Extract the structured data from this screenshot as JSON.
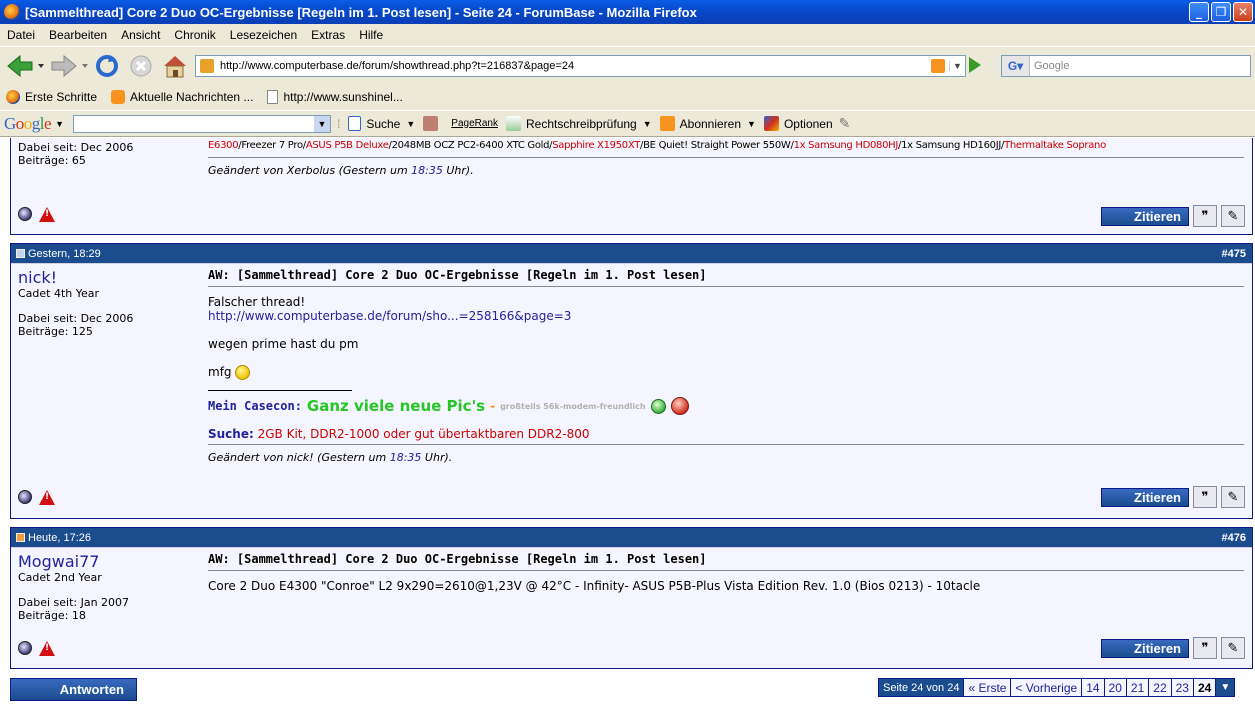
{
  "window": {
    "title": "[Sammelthread] Core 2 Duo OC-Ergebnisse [Regeln im 1. Post lesen] - Seite 24 - ForumBase - Mozilla Firefox"
  },
  "menu": [
    "Datei",
    "Bearbeiten",
    "Ansicht",
    "Chronik",
    "Lesezeichen",
    "Extras",
    "Hilfe"
  ],
  "nav": {
    "url": "http://www.computerbase.de/forum/showthread.php?t=216837&page=24",
    "search_placeholder": "Google"
  },
  "bookmarks": [
    {
      "label": "Erste Schritte",
      "icon": "firefox-icon"
    },
    {
      "label": "Aktuelle Nachrichten ...",
      "icon": "rss-icon"
    },
    {
      "label": "http://www.sunshinel...",
      "icon": "page-icon"
    }
  ],
  "gtoolbar": {
    "logo": "Google",
    "suche": "Suche",
    "pagerank": "PageRank",
    "spell": "Rechtschreibprüfung",
    "subscribe": "Abonnieren",
    "options": "Optionen"
  },
  "posts": [
    {
      "joined": "Dabei seit: Dec 2006",
      "posts": "Beiträge: 65",
      "signature": {
        "parts": [
          {
            "text": "E6300",
            "color": "red"
          },
          {
            "text": "/Freezer 7 Pro/",
            "color": "black"
          },
          {
            "text": "ASUS P5B Deluxe",
            "color": "red"
          },
          {
            "text": "/2048MB OCZ PC2-6400 XTC Gold/",
            "color": "black"
          },
          {
            "text": "Sapphire X1950XT",
            "color": "red"
          },
          {
            "text": "/BE Quiet! Straight Power 550W/",
            "color": "black"
          },
          {
            "text": "1x Samsung HD080HJ",
            "color": "red"
          },
          {
            "text": "/1x Samsung HD160JJ/",
            "color": "black"
          },
          {
            "text": "Thermaltake Soprano",
            "color": "red"
          }
        ]
      },
      "edited_prefix": "Geändert von Xerbolus (Gestern um",
      "edited_time": "18:35",
      "edited_suffix": "Uhr).",
      "quote_label": "Zitieren"
    },
    {
      "date": "Gestern, 18:29",
      "number": "#475",
      "username": "nick!",
      "rank": "Cadet 4th Year",
      "joined": "Dabei seit: Dec 2006",
      "posts": "Beiträge: 125",
      "title": "AW: [Sammelthread] Core 2 Duo OC-Ergebnisse [Regeln im 1. Post lesen]",
      "line1": "Falscher thread!",
      "link": "http://www.computerbase.de/forum/sho...=258166&page=3",
      "line2": "wegen prime hast du pm",
      "line3": "mfg",
      "sig_casecon_label": "Mein Casecon:",
      "sig_casecon_text": "Ganz viele neue Pic's",
      "sig_dash": "-",
      "sig_small": "großteils 56k-modem-freundlich",
      "sig_suche_label": "Suche:",
      "sig_suche_text": "2GB Kit, DDR2-1000 oder gut übertaktbaren DDR2-800",
      "edited_prefix": "Geändert von nick! (Gestern um",
      "edited_time": "18:35",
      "edited_suffix": "Uhr).",
      "quote_label": "Zitieren"
    },
    {
      "date": "Heute, 17:26",
      "number": "#476",
      "username": "Mogwai77",
      "rank": "Cadet 2nd Year",
      "joined": "Dabei seit: Jan 2007",
      "posts": "Beiträge: 18",
      "title": "AW: [Sammelthread] Core 2 Duo OC-Ergebnisse [Regeln im 1. Post lesen]",
      "line1": "Core 2 Duo E4300 \"Conroe\" L2 9x290=2610@1,23V @ 42°C - Infinity- ASUS P5B-Plus Vista Edition Rev. 1.0 (Bios 0213) - 10tacle",
      "quote_label": "Zitieren"
    }
  ],
  "reply_label": "Antworten",
  "pagenav": {
    "info": "Seite 24 von 24",
    "first": "« Erste",
    "prev": "< Vorherige",
    "pages": [
      "14",
      "20",
      "21",
      "22",
      "23"
    ],
    "current": "24"
  }
}
